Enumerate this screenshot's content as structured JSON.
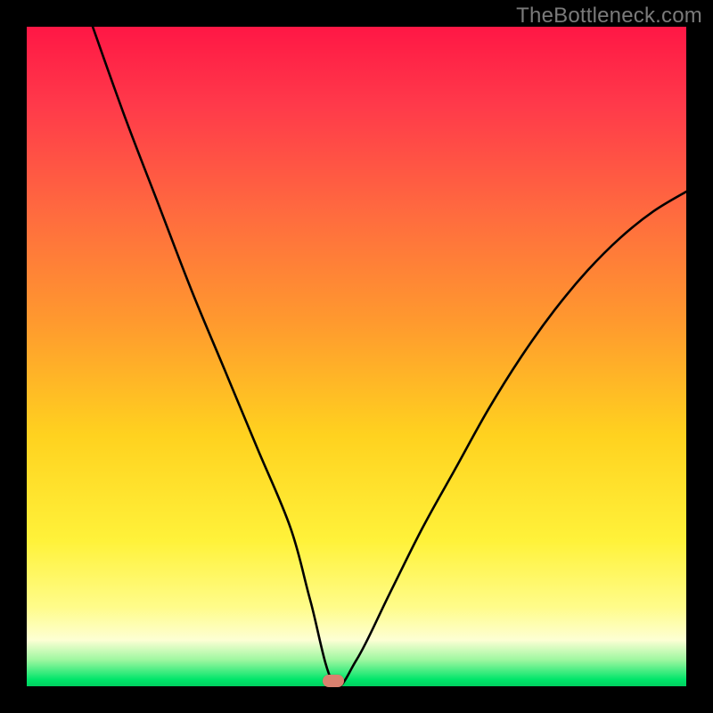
{
  "watermark": "TheBottleneck.com",
  "chart_data": {
    "type": "line",
    "title": "",
    "xlabel": "",
    "ylabel": "",
    "xlim": [
      0,
      100
    ],
    "ylim": [
      0,
      100
    ],
    "grid": false,
    "legend": false,
    "series": [
      {
        "name": "bottleneck-curve",
        "x": [
          10,
          15,
          20,
          25,
          30,
          35,
          40,
          43,
          46.5,
          50,
          55,
          60,
          65,
          70,
          75,
          80,
          85,
          90,
          95,
          100
        ],
        "values": [
          100,
          86,
          73,
          60,
          48,
          36,
          24,
          13,
          0.5,
          4,
          14,
          24,
          33,
          42,
          50,
          57,
          63,
          68,
          72,
          75
        ]
      }
    ],
    "marker": {
      "x": 46.5,
      "y": 0.8,
      "color": "#d9816f"
    },
    "gradient_stops": [
      {
        "pos": 0.0,
        "color": "#ff1745"
      },
      {
        "pos": 0.12,
        "color": "#ff3a4a"
      },
      {
        "pos": 0.28,
        "color": "#ff6a3f"
      },
      {
        "pos": 0.45,
        "color": "#ff9a2e"
      },
      {
        "pos": 0.62,
        "color": "#ffd21f"
      },
      {
        "pos": 0.78,
        "color": "#fff23a"
      },
      {
        "pos": 0.88,
        "color": "#fffc8a"
      },
      {
        "pos": 0.93,
        "color": "#fdffd4"
      },
      {
        "pos": 0.96,
        "color": "#9ef7a0"
      },
      {
        "pos": 0.99,
        "color": "#00e56a"
      },
      {
        "pos": 1.0,
        "color": "#00d060"
      }
    ]
  }
}
